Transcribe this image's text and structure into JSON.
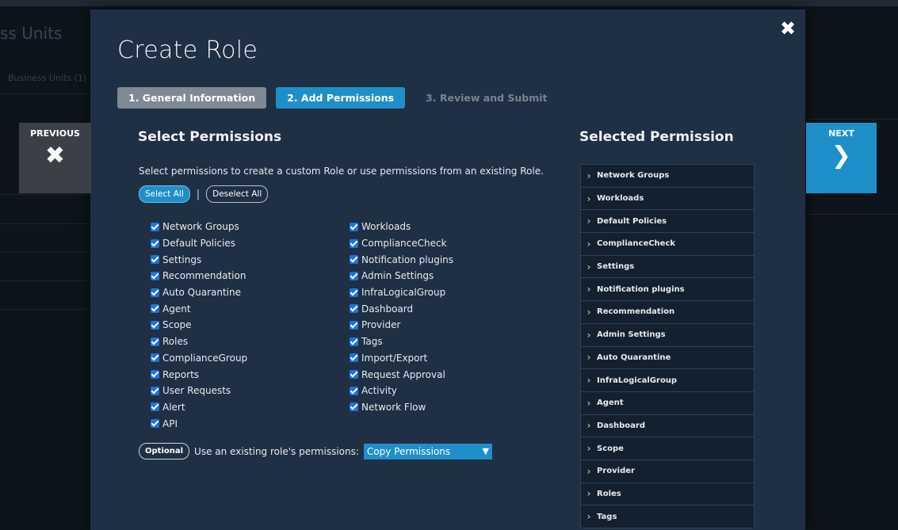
{
  "background": {
    "title": "ss Units",
    "subtitle": "Business Units (1)"
  },
  "modal": {
    "title": "Create Role",
    "close_icon": "close-icon",
    "steps": [
      {
        "label": "1. General Information",
        "state": "completed"
      },
      {
        "label": "2. Add Permissions",
        "state": "active"
      },
      {
        "label": "3. Review and Submit",
        "state": "upcoming"
      }
    ],
    "select_permissions": {
      "title": "Select Permissions",
      "description": "Select permissions to create a custom Role or use permissions from an existing Role.",
      "select_all": "Select All",
      "separator": "|",
      "deselect_all": "Deselect All",
      "left_column": [
        {
          "label": "Network Groups",
          "checked": true
        },
        {
          "label": "Default Policies",
          "checked": true
        },
        {
          "label": "Settings",
          "checked": true
        },
        {
          "label": "Recommendation",
          "checked": true
        },
        {
          "label": "Auto Quarantine",
          "checked": true
        },
        {
          "label": "Agent",
          "checked": true
        },
        {
          "label": "Scope",
          "checked": true
        },
        {
          "label": "Roles",
          "checked": true
        },
        {
          "label": "ComplianceGroup",
          "checked": true
        },
        {
          "label": "Reports",
          "checked": true
        },
        {
          "label": "User Requests",
          "checked": true
        },
        {
          "label": "Alert",
          "checked": true
        },
        {
          "label": "API",
          "checked": true
        }
      ],
      "right_column": [
        {
          "label": "Workloads",
          "checked": true
        },
        {
          "label": "ComplianceCheck",
          "checked": true
        },
        {
          "label": "Notification plugins",
          "checked": true
        },
        {
          "label": "Admin Settings",
          "checked": true
        },
        {
          "label": "InfraLogicalGroup",
          "checked": true
        },
        {
          "label": "Dashboard",
          "checked": true
        },
        {
          "label": "Provider",
          "checked": true
        },
        {
          "label": "Tags",
          "checked": true
        },
        {
          "label": "Import/Export",
          "checked": true
        },
        {
          "label": "Request Approval",
          "checked": true
        },
        {
          "label": "Activity",
          "checked": true
        },
        {
          "label": "Network Flow",
          "checked": true
        }
      ],
      "optional_badge": "Optional",
      "optional_label": "Use an existing role's permissions:",
      "copy_select_value": "Copy Permissions"
    },
    "selected_permission": {
      "title": "Selected Permission",
      "items": [
        "Network Groups",
        "Workloads",
        "Default Policies",
        "ComplianceCheck",
        "Settings",
        "Notification plugins",
        "Recommendation",
        "Admin Settings",
        "Auto Quarantine",
        "InfraLogicalGroup",
        "Agent",
        "Dashboard",
        "Scope",
        "Provider",
        "Roles",
        "Tags"
      ]
    }
  },
  "nav": {
    "previous_label": "PREVIOUS",
    "previous_icon": "close-icon",
    "next_label": "NEXT",
    "next_icon": "chevron-right-icon"
  },
  "colors": {
    "accent": "#1f8fc9",
    "modal_bg": "#1f2f44",
    "page_bg": "#0e141b"
  }
}
